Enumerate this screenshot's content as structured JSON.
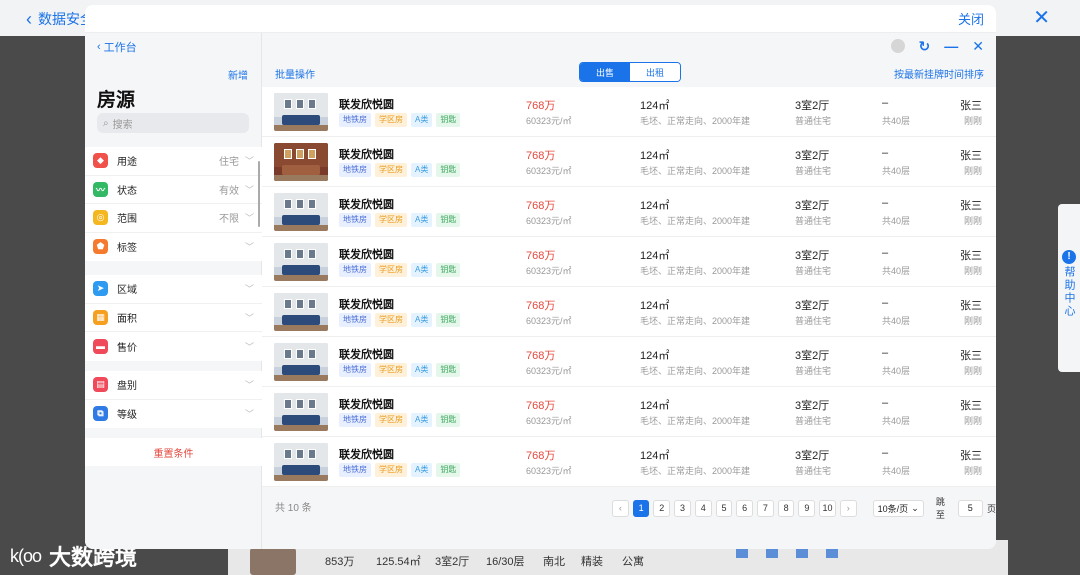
{
  "background": {
    "back_label": "数据安全",
    "bottom_stats": [
      {
        "value": "853万",
        "label": ""
      },
      {
        "value": "125.54㎡",
        "label": ""
      },
      {
        "value": "3室2厅",
        "label": ""
      },
      {
        "value": "16/30层",
        "label": ""
      },
      {
        "value": "南北",
        "label": ""
      },
      {
        "value": "精装",
        "label": ""
      },
      {
        "value": "公寓",
        "label": ""
      }
    ],
    "logo_text": "大数跨境",
    "logo_mark": "k(oo",
    "help_label": "帮助中心"
  },
  "modal": {
    "close_label": "关闭"
  },
  "sidebar": {
    "back_label": "工作台",
    "add_label": "新增",
    "title": "房源",
    "search_placeholder": "搜索",
    "group1": [
      {
        "label": "用途",
        "value": "住宅",
        "icon": "usage-icon",
        "color": "#f0524b",
        "glyph": "◆"
      },
      {
        "label": "状态",
        "value": "有效",
        "icon": "status-icon",
        "color": "#33b864",
        "glyph": "〰"
      },
      {
        "label": "范围",
        "value": "不限",
        "icon": "range-icon",
        "color": "#f5b720",
        "glyph": "◎"
      },
      {
        "label": "标签",
        "value": "",
        "icon": "tag-icon",
        "color": "#f57a2d",
        "glyph": "⬟"
      }
    ],
    "group2": [
      {
        "label": "区域",
        "value": "",
        "icon": "region-icon",
        "color": "#2f9bf0",
        "glyph": "➤"
      },
      {
        "label": "面积",
        "value": "",
        "icon": "area-icon",
        "color": "#f5a020",
        "glyph": "▦"
      },
      {
        "label": "售价",
        "value": "",
        "icon": "price-icon",
        "color": "#f04a5a",
        "glyph": "▬"
      }
    ],
    "group3": [
      {
        "label": "盘别",
        "value": "",
        "icon": "category-icon",
        "color": "#f04a5a",
        "glyph": "▤"
      },
      {
        "label": "等级",
        "value": "",
        "icon": "level-icon",
        "color": "#2f7ae5",
        "glyph": "⧉"
      }
    ],
    "reset_label": "重置条件"
  },
  "toolbar": {
    "batch_label": "批量操作",
    "tab_sale": "出售",
    "tab_rent": "出租",
    "sort_label": "按最新挂牌时间排序"
  },
  "listings": [
    {
      "name": "联发欣悦圆",
      "tags": [
        "地铁房",
        "学区房",
        "A类",
        "钥匙"
      ],
      "price": "768万",
      "unit_price": "60323元/㎡",
      "area": "124㎡",
      "desc": "毛坯、正常走向、2000年建",
      "layout": "3室2厅",
      "type": "普通住宅",
      "floor": "–",
      "floors": "共40层",
      "agent": "张三",
      "time": "刚刚",
      "photo": "living-room"
    },
    {
      "name": "联发欣悦圆",
      "tags": [
        "地铁房",
        "学区房",
        "A类",
        "钥匙"
      ],
      "price": "768万",
      "unit_price": "60323元/㎡",
      "area": "124㎡",
      "desc": "毛坯、正常走向、2000年建",
      "layout": "3室2厅",
      "type": "普通住宅",
      "floor": "–",
      "floors": "共40层",
      "agent": "张三",
      "time": "刚刚",
      "photo": "dining-room"
    },
    {
      "name": "联发欣悦圆",
      "tags": [
        "地铁房",
        "学区房",
        "A类",
        "钥匙"
      ],
      "price": "768万",
      "unit_price": "60323元/㎡",
      "area": "124㎡",
      "desc": "毛坯、正常走向、2000年建",
      "layout": "3室2厅",
      "type": "普通住宅",
      "floor": "–",
      "floors": "共40层",
      "agent": "张三",
      "time": "刚刚",
      "photo": "living-room"
    },
    {
      "name": "联发欣悦圆",
      "tags": [
        "地铁房",
        "学区房",
        "A类",
        "钥匙"
      ],
      "price": "768万",
      "unit_price": "60323元/㎡",
      "area": "124㎡",
      "desc": "毛坯、正常走向、2000年建",
      "layout": "3室2厅",
      "type": "普通住宅",
      "floor": "–",
      "floors": "共40层",
      "agent": "张三",
      "time": "刚刚",
      "photo": "living-room"
    },
    {
      "name": "联发欣悦圆",
      "tags": [
        "地铁房",
        "学区房",
        "A类",
        "钥匙"
      ],
      "price": "768万",
      "unit_price": "60323元/㎡",
      "area": "124㎡",
      "desc": "毛坯、正常走向、2000年建",
      "layout": "3室2厅",
      "type": "普通住宅",
      "floor": "–",
      "floors": "共40层",
      "agent": "张三",
      "time": "刚刚",
      "photo": "living-room"
    },
    {
      "name": "联发欣悦圆",
      "tags": [
        "地铁房",
        "学区房",
        "A类",
        "钥匙"
      ],
      "price": "768万",
      "unit_price": "60323元/㎡",
      "area": "124㎡",
      "desc": "毛坯、正常走向、2000年建",
      "layout": "3室2厅",
      "type": "普通住宅",
      "floor": "–",
      "floors": "共40层",
      "agent": "张三",
      "time": "刚刚",
      "photo": "living-room"
    },
    {
      "name": "联发欣悦圆",
      "tags": [
        "地铁房",
        "学区房",
        "A类",
        "钥匙"
      ],
      "price": "768万",
      "unit_price": "60323元/㎡",
      "area": "124㎡",
      "desc": "毛坯、正常走向、2000年建",
      "layout": "3室2厅",
      "type": "普通住宅",
      "floor": "–",
      "floors": "共40层",
      "agent": "张三",
      "time": "刚刚",
      "photo": "living-room"
    },
    {
      "name": "联发欣悦圆",
      "tags": [
        "地铁房",
        "学区房",
        "A类",
        "钥匙"
      ],
      "price": "768万",
      "unit_price": "60323元/㎡",
      "area": "124㎡",
      "desc": "毛坯、正常走向、2000年建",
      "layout": "3室2厅",
      "type": "普通住宅",
      "floor": "–",
      "floors": "共40层",
      "agent": "张三",
      "time": "刚刚",
      "photo": "living-room"
    }
  ],
  "pagination": {
    "total_label": "共 10 条",
    "pages": [
      "1",
      "2",
      "3",
      "4",
      "5",
      "6",
      "7",
      "8",
      "9",
      "10"
    ],
    "current": "1",
    "per_page": "10条/页",
    "jump_label": "跳至",
    "jump_value": "5",
    "page_suffix": "页"
  },
  "colors": {
    "accent": "#1a73e8",
    "price": "#e5483e",
    "reset": "#e5483e"
  }
}
